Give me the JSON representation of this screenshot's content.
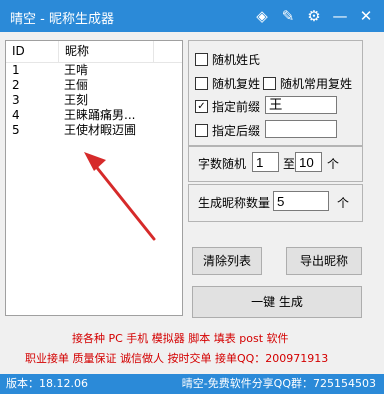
{
  "title": "晴空 - 昵称生成器",
  "titlebar_icons": [
    "shirt-icon",
    "edit-icon",
    "settings-icon",
    "minimize-icon",
    "close-icon"
  ],
  "list": {
    "headers": [
      "ID",
      "昵称"
    ],
    "rows": [
      {
        "id": "1",
        "name": "王啃"
      },
      {
        "id": "2",
        "name": "王俪"
      },
      {
        "id": "3",
        "name": "王刻"
      },
      {
        "id": "4",
        "name": "王睐踊痛男..."
      },
      {
        "id": "5",
        "name": "王使材睱迈圃"
      }
    ]
  },
  "options": {
    "random_surname": "随机姓氏",
    "random_compound_surname": "随机复姓",
    "random_common_compound": "随机常用复姓",
    "prefix_label": "指定前缀",
    "prefix_value": "王",
    "prefix_checked": true,
    "suffix_label": "指定后缀",
    "suffix_value": ""
  },
  "length": {
    "label": "字数随机",
    "min": "1",
    "to": "至",
    "max": "10",
    "unit": "个"
  },
  "count": {
    "label": "生成昵称数量",
    "value": "5",
    "unit": "个"
  },
  "buttons": {
    "clear": "清除列表",
    "export": "导出昵称",
    "generate": "一键 生成"
  },
  "ad": {
    "line1": "接各种 PC 手机 模拟器 脚本 填表 post 软件",
    "line2": "职业接单 质量保证 诚信做人 按时交单 接单QQ：200971913"
  },
  "status": {
    "version": "版本：18.12.06",
    "qq_group": "晴空-免费软件分享QQ群：725154503"
  },
  "colors": {
    "titlebar": "#2b8ad8",
    "ad_text": "#d40000",
    "annotation": "#d62a2a"
  }
}
